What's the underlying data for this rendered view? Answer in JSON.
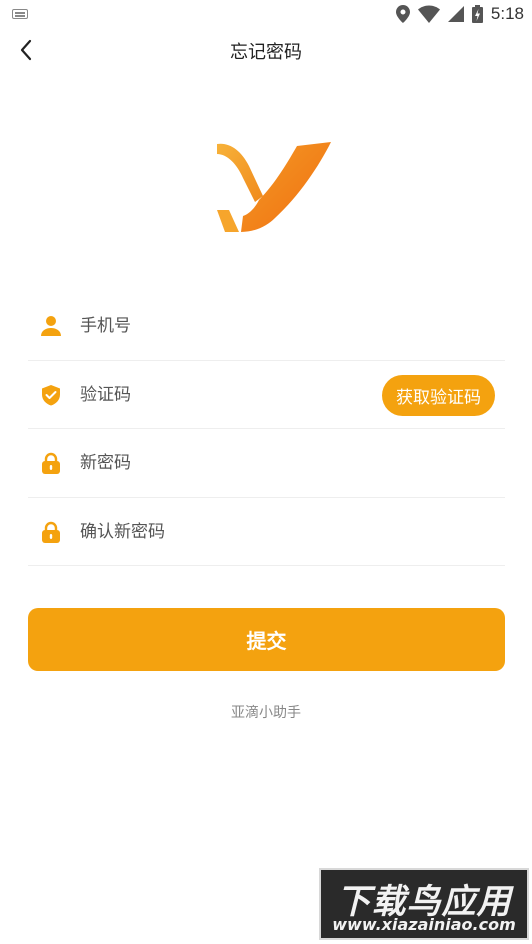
{
  "status_bar": {
    "time": "5:18",
    "icons": [
      "keyboard-icon",
      "location-icon",
      "wifi-icon",
      "signal-icon",
      "battery-icon"
    ]
  },
  "header": {
    "title": "忘记密码",
    "back_icon": "chevron-left-icon"
  },
  "logo": {
    "colors": [
      "#f5a623",
      "#f07c14"
    ]
  },
  "form": {
    "phone_placeholder": "手机号",
    "code_placeholder": "验证码",
    "get_code_label": "获取验证码",
    "new_password_placeholder": "新密码",
    "confirm_password_placeholder": "确认新密码"
  },
  "submit_label": "提交",
  "footer_text": "亚滴小助手",
  "watermark": {
    "line1": "下载鸟应用",
    "line2": "www.xiazainiao.com"
  },
  "colors": {
    "accent": "#f4a20f",
    "divider": "#eeeeee",
    "placeholder": "#555555"
  }
}
